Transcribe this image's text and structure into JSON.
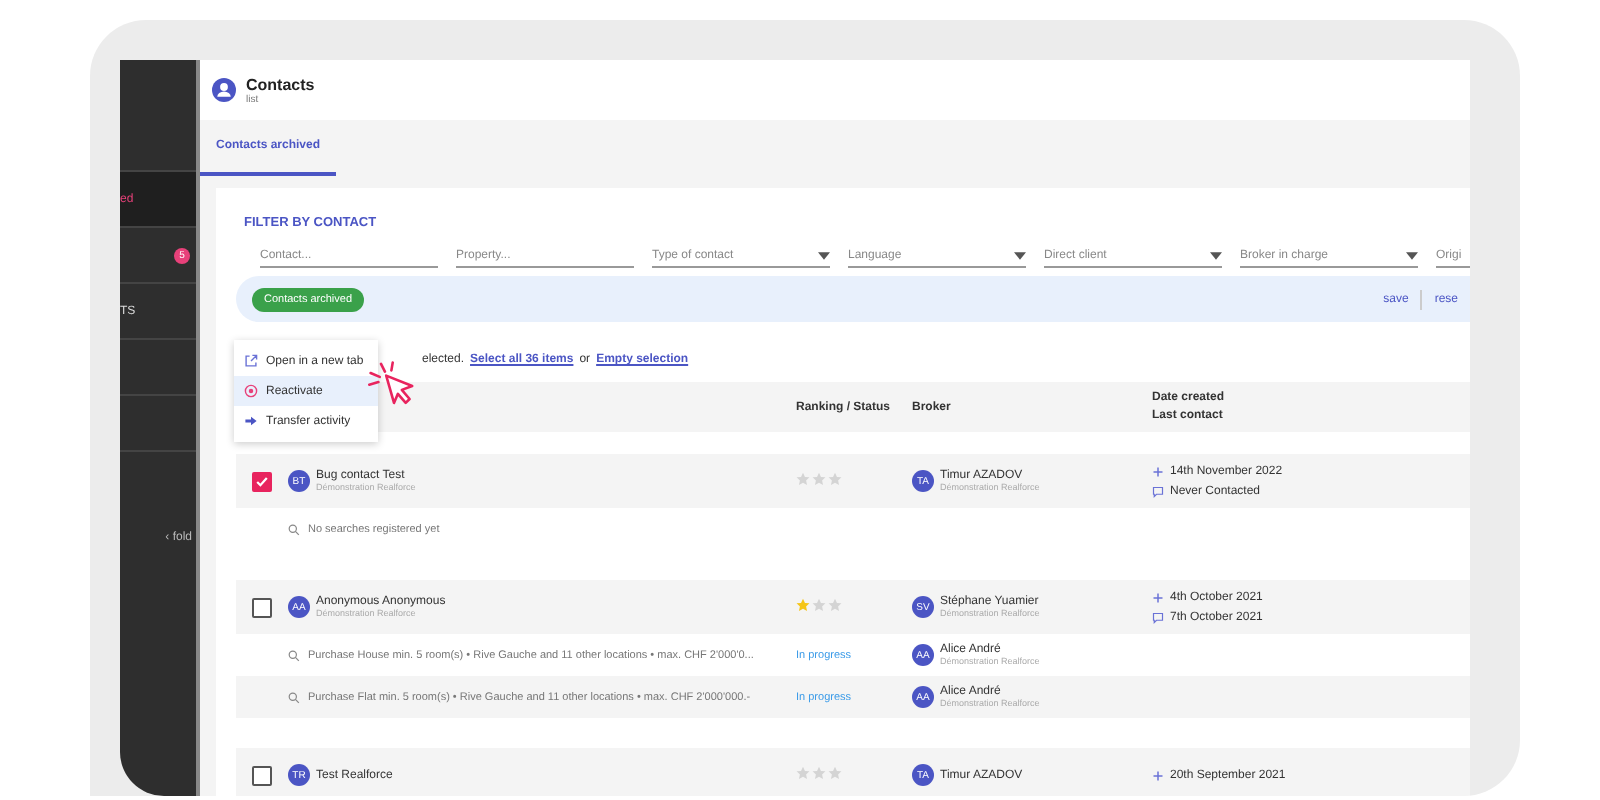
{
  "sidebar": {
    "items": [
      {
        "label": "ed",
        "selected": true
      },
      {
        "selected": false,
        "badge": "5"
      },
      {
        "label": "TS",
        "selected": false
      }
    ],
    "fold": "‹ fold"
  },
  "header": {
    "title": "Contacts",
    "subtitle": "list"
  },
  "tabs": [
    {
      "label": "Contacts archived",
      "selected": true
    }
  ],
  "filter": {
    "title": "FILTER BY CONTACT",
    "fields": [
      {
        "kind": "text",
        "placeholder": "Contact..."
      },
      {
        "kind": "text",
        "placeholder": "Property..."
      },
      {
        "kind": "select",
        "placeholder": "Type of contact"
      },
      {
        "kind": "select",
        "placeholder": "Language"
      },
      {
        "kind": "select",
        "placeholder": "Direct client"
      },
      {
        "kind": "select",
        "placeholder": "Broker in charge"
      },
      {
        "kind": "text",
        "placeholder": "Origi"
      }
    ],
    "chip": "Contacts archived",
    "save": "save",
    "reset": "rese"
  },
  "selection": {
    "text": "elected.",
    "select_all": "Select all 36 items",
    "or": "or",
    "empty": "Empty selection"
  },
  "context_menu": [
    {
      "label": "Open in a new tab",
      "kind": "open",
      "selected": false
    },
    {
      "label": "Reactivate",
      "kind": "reactivate",
      "selected": true
    },
    {
      "label": "Transfer activity",
      "kind": "transfer",
      "selected": false
    }
  ],
  "table": {
    "columns": [
      "Ranking / Status",
      "Broker",
      "Date created",
      "Last contact"
    ],
    "rows": [
      {
        "checked": true,
        "initials": "BT",
        "name": "Bug contact Test",
        "agency": "Démonstration Realforce",
        "stars": 0,
        "broker_initials": "TA",
        "broker": "Timur AZADOV",
        "broker_agency": "Démonstration Realforce",
        "created": "14th November 2022",
        "last_contact": "Never Contacted",
        "searches": [
          {
            "text": "No searches registered yet"
          }
        ]
      },
      {
        "checked": false,
        "initials": "AA",
        "name": "Anonymous Anonymous",
        "agency": "Démonstration Realforce",
        "stars": 1,
        "broker_initials": "SV",
        "broker": "Stéphane Yuamier",
        "broker_agency": "Démonstration Realforce",
        "created": "4th October 2021",
        "last_contact": "7th October 2021",
        "searches": [
          {
            "text": "Purchase House min. 5 room(s) • Rive Gauche and 11 other locations • max. CHF 2'000'0...",
            "status": "In progress",
            "broker_initials": "AA",
            "broker": "Alice André",
            "broker_agency": "Démonstration Realforce"
          },
          {
            "text": "Purchase Flat min. 5 room(s) • Rive Gauche and 11 other locations • max. CHF 2'000'000.-",
            "status": "In progress",
            "broker_initials": "AA",
            "broker": "Alice André",
            "broker_agency": "Démonstration Realforce"
          }
        ]
      },
      {
        "checked": false,
        "initials": "TR",
        "name": "Test Realforce",
        "stars": 0,
        "broker_initials": "TA",
        "broker": "Timur AZADOV",
        "created": "20th September 2021"
      }
    ]
  }
}
